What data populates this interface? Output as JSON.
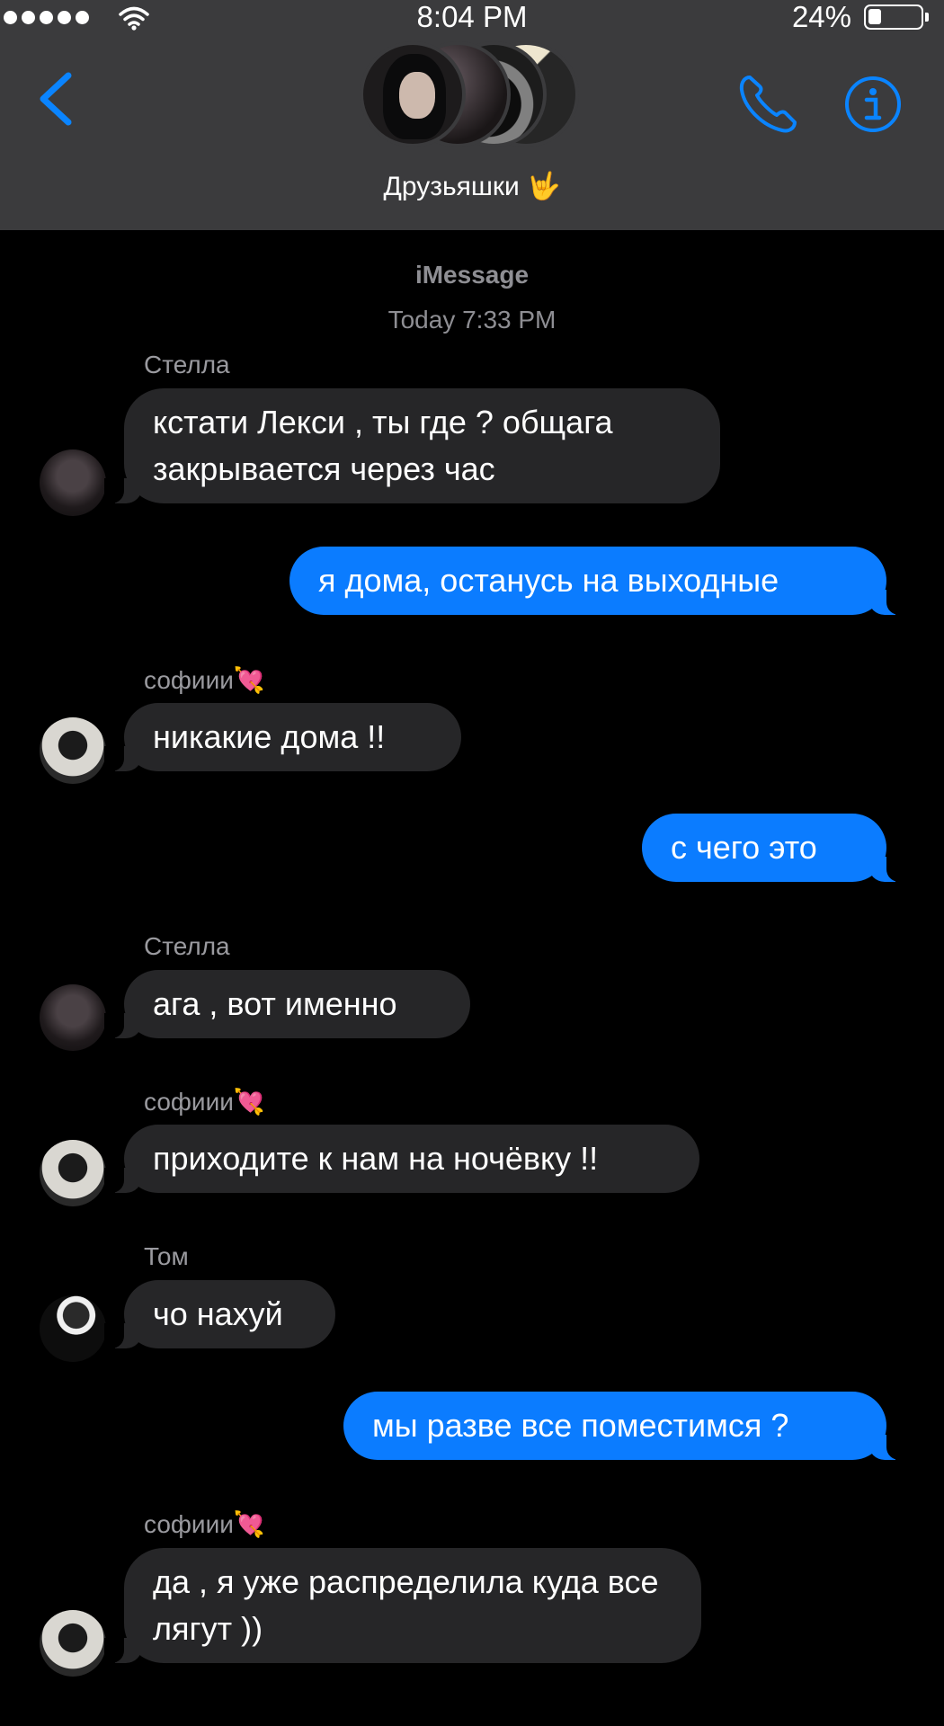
{
  "status_bar": {
    "time": "8:04 PM",
    "battery_percent": "24%",
    "battery_level": 0.24,
    "signal_bars": 5,
    "icons": [
      "signal-icon",
      "wifi-icon",
      "battery-icon"
    ]
  },
  "header": {
    "group_name": "Друзьяшки 🤟",
    "icons": [
      "back-chevron-icon",
      "phone-icon",
      "info-icon"
    ],
    "accent_color": "#0a84ff"
  },
  "chat": {
    "service": "iMessage",
    "timestamp": "Today 7:33 PM",
    "incoming_bubble_color": "#262628",
    "outgoing_bubble_color": "#0b7cff",
    "messages": [
      {
        "direction": "in",
        "sender": "Стелла",
        "text": "кстати Лекси , ты где ? общага закрывается через час"
      },
      {
        "direction": "out",
        "text": "я дома, останусь на выходные"
      },
      {
        "direction": "in",
        "sender": "софиии💘",
        "text": "никакие дома !!"
      },
      {
        "direction": "out",
        "text": "с чего это"
      },
      {
        "direction": "in",
        "sender": "Стелла",
        "text": "ага , вот именно"
      },
      {
        "direction": "in",
        "sender": "софиии💘",
        "text": "приходите к нам на ночёвку !!"
      },
      {
        "direction": "in",
        "sender": "Том",
        "text": "чо нахуй"
      },
      {
        "direction": "out",
        "text": "мы разве все поместимся ?"
      },
      {
        "direction": "in",
        "sender": "софиии💘",
        "text": "да , я уже распределила куда все лягут ))"
      }
    ]
  }
}
